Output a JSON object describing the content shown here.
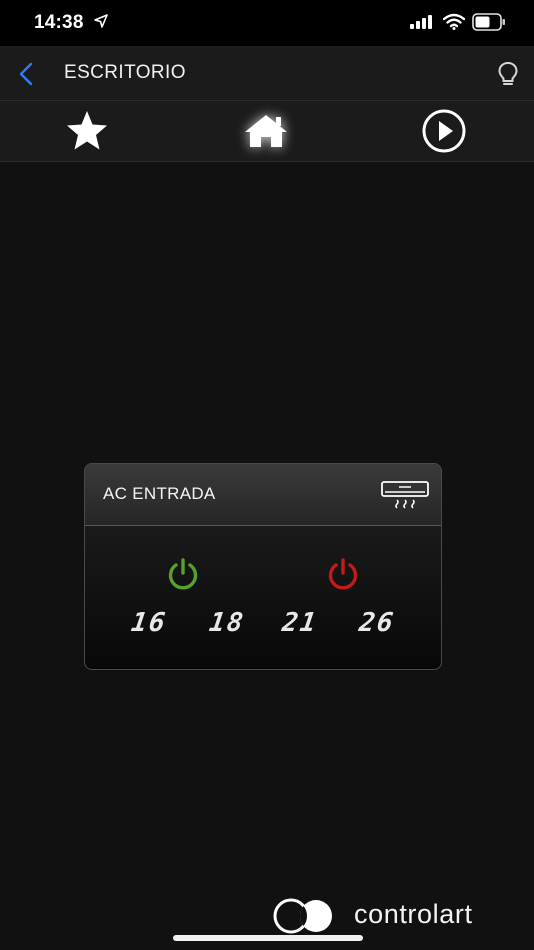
{
  "status_bar": {
    "time": "14:38",
    "location_icon": "location-arrow-icon",
    "signal_icon": "cellular-signal-icon",
    "wifi_icon": "wifi-icon",
    "battery_icon": "battery-icon"
  },
  "header": {
    "title": "ESCRITORIO",
    "back_icon": "chevron-left-icon",
    "bulb_icon": "lightbulb-icon",
    "accent_color": "#2f7cf6"
  },
  "tabs": [
    {
      "icon": "star-icon"
    },
    {
      "icon": "home-icon",
      "active": true
    },
    {
      "icon": "play-icon"
    }
  ],
  "ac_card": {
    "title": "AC ENTRADA",
    "device_icon": "air-conditioner-icon",
    "power_on_icon": "power-on-icon",
    "power_on_color": "#5aa02c",
    "power_off_icon": "power-off-icon",
    "power_off_color": "#c41a1a",
    "temperatures": [
      "16",
      "18",
      "21",
      "26"
    ]
  },
  "brand": {
    "name": "controlart",
    "logo_icon": "controlart-logo-icon"
  }
}
